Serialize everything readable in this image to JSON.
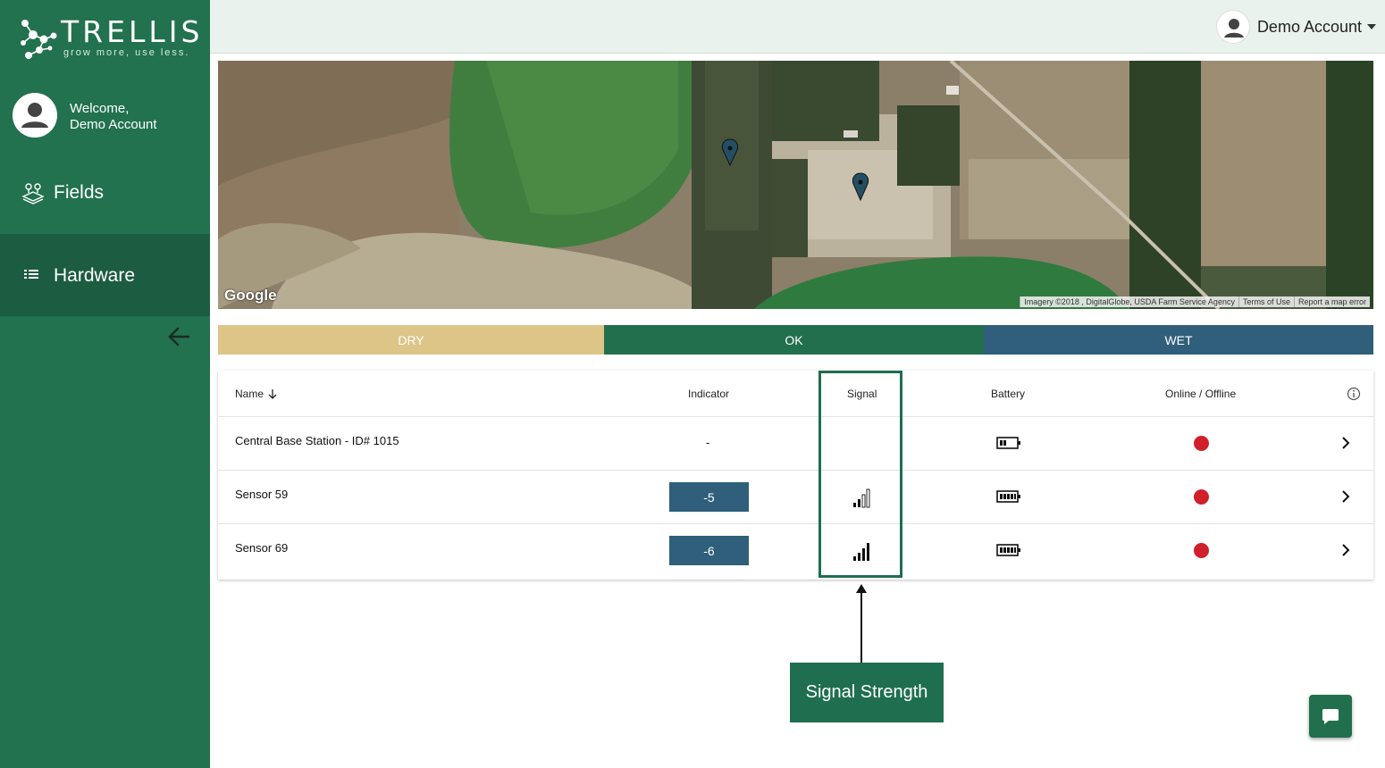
{
  "brand": {
    "name": "TRELLIS",
    "tagline": "grow more, use less."
  },
  "sidebar": {
    "welcome_line1": "Welcome,",
    "welcome_line2": "Demo Account",
    "items": [
      {
        "label": "Fields",
        "icon": "map-layers-icon"
      },
      {
        "label": "Hardware",
        "icon": "list-icon",
        "active": true
      }
    ],
    "collapse_icon": "arrow-left-icon"
  },
  "header": {
    "account_name": "Demo Account",
    "avatar_icon": "user-avatar-icon"
  },
  "map": {
    "logo": "Google",
    "attribution": [
      "Imagery ©2018 , DigitalGlobe, USDA Farm Service Agency",
      "Terms of Use",
      "Report a map error"
    ],
    "marker_icon": "map-pin-icon"
  },
  "legend": {
    "dry": "DRY",
    "ok": "OK",
    "wet": "WET",
    "colors": {
      "dry": "#dcc586",
      "ok": "#226f4d",
      "wet": "#2f5f7a"
    }
  },
  "table": {
    "headers": {
      "name": "Name",
      "indicator": "Indicator",
      "signal": "Signal",
      "battery": "Battery",
      "online": "Online / Offline"
    },
    "rows": [
      {
        "name": "Central Base Station - ID# 1015",
        "indicator": "-",
        "signal_bars": null,
        "battery_level": 0.4,
        "status": "offline"
      },
      {
        "name": "Sensor 59",
        "indicator": "-5",
        "signal_bars": 2,
        "battery_level": 1.0,
        "status": "offline"
      },
      {
        "name": "Sensor 69",
        "indicator": "-6",
        "signal_bars": 4,
        "battery_level": 1.0,
        "status": "offline"
      }
    ],
    "status_color": "#d0202a"
  },
  "annotation": {
    "label": "Signal Strength"
  },
  "chat": {
    "icon": "chat-bubble-icon"
  }
}
